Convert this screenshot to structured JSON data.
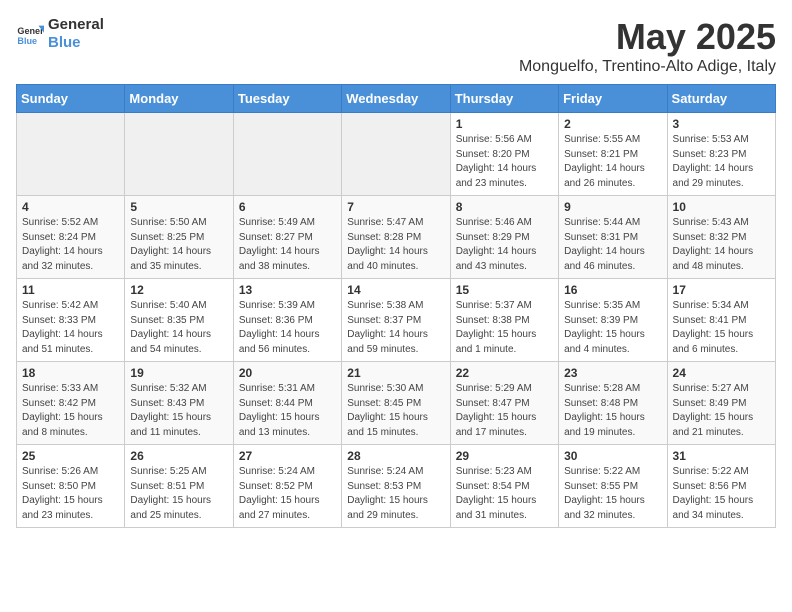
{
  "logo": {
    "line1": "General",
    "line2": "Blue"
  },
  "title": "May 2025",
  "subtitle": "Monguelfo, Trentino-Alto Adige, Italy",
  "headers": [
    "Sunday",
    "Monday",
    "Tuesday",
    "Wednesday",
    "Thursday",
    "Friday",
    "Saturday"
  ],
  "weeks": [
    [
      {
        "day": "",
        "content": ""
      },
      {
        "day": "",
        "content": ""
      },
      {
        "day": "",
        "content": ""
      },
      {
        "day": "",
        "content": ""
      },
      {
        "day": "1",
        "content": "Sunrise: 5:56 AM\nSunset: 8:20 PM\nDaylight: 14 hours and 23 minutes."
      },
      {
        "day": "2",
        "content": "Sunrise: 5:55 AM\nSunset: 8:21 PM\nDaylight: 14 hours and 26 minutes."
      },
      {
        "day": "3",
        "content": "Sunrise: 5:53 AM\nSunset: 8:23 PM\nDaylight: 14 hours and 29 minutes."
      }
    ],
    [
      {
        "day": "4",
        "content": "Sunrise: 5:52 AM\nSunset: 8:24 PM\nDaylight: 14 hours and 32 minutes."
      },
      {
        "day": "5",
        "content": "Sunrise: 5:50 AM\nSunset: 8:25 PM\nDaylight: 14 hours and 35 minutes."
      },
      {
        "day": "6",
        "content": "Sunrise: 5:49 AM\nSunset: 8:27 PM\nDaylight: 14 hours and 38 minutes."
      },
      {
        "day": "7",
        "content": "Sunrise: 5:47 AM\nSunset: 8:28 PM\nDaylight: 14 hours and 40 minutes."
      },
      {
        "day": "8",
        "content": "Sunrise: 5:46 AM\nSunset: 8:29 PM\nDaylight: 14 hours and 43 minutes."
      },
      {
        "day": "9",
        "content": "Sunrise: 5:44 AM\nSunset: 8:31 PM\nDaylight: 14 hours and 46 minutes."
      },
      {
        "day": "10",
        "content": "Sunrise: 5:43 AM\nSunset: 8:32 PM\nDaylight: 14 hours and 48 minutes."
      }
    ],
    [
      {
        "day": "11",
        "content": "Sunrise: 5:42 AM\nSunset: 8:33 PM\nDaylight: 14 hours and 51 minutes."
      },
      {
        "day": "12",
        "content": "Sunrise: 5:40 AM\nSunset: 8:35 PM\nDaylight: 14 hours and 54 minutes."
      },
      {
        "day": "13",
        "content": "Sunrise: 5:39 AM\nSunset: 8:36 PM\nDaylight: 14 hours and 56 minutes."
      },
      {
        "day": "14",
        "content": "Sunrise: 5:38 AM\nSunset: 8:37 PM\nDaylight: 14 hours and 59 minutes."
      },
      {
        "day": "15",
        "content": "Sunrise: 5:37 AM\nSunset: 8:38 PM\nDaylight: 15 hours and 1 minute."
      },
      {
        "day": "16",
        "content": "Sunrise: 5:35 AM\nSunset: 8:39 PM\nDaylight: 15 hours and 4 minutes."
      },
      {
        "day": "17",
        "content": "Sunrise: 5:34 AM\nSunset: 8:41 PM\nDaylight: 15 hours and 6 minutes."
      }
    ],
    [
      {
        "day": "18",
        "content": "Sunrise: 5:33 AM\nSunset: 8:42 PM\nDaylight: 15 hours and 8 minutes."
      },
      {
        "day": "19",
        "content": "Sunrise: 5:32 AM\nSunset: 8:43 PM\nDaylight: 15 hours and 11 minutes."
      },
      {
        "day": "20",
        "content": "Sunrise: 5:31 AM\nSunset: 8:44 PM\nDaylight: 15 hours and 13 minutes."
      },
      {
        "day": "21",
        "content": "Sunrise: 5:30 AM\nSunset: 8:45 PM\nDaylight: 15 hours and 15 minutes."
      },
      {
        "day": "22",
        "content": "Sunrise: 5:29 AM\nSunset: 8:47 PM\nDaylight: 15 hours and 17 minutes."
      },
      {
        "day": "23",
        "content": "Sunrise: 5:28 AM\nSunset: 8:48 PM\nDaylight: 15 hours and 19 minutes."
      },
      {
        "day": "24",
        "content": "Sunrise: 5:27 AM\nSunset: 8:49 PM\nDaylight: 15 hours and 21 minutes."
      }
    ],
    [
      {
        "day": "25",
        "content": "Sunrise: 5:26 AM\nSunset: 8:50 PM\nDaylight: 15 hours and 23 minutes."
      },
      {
        "day": "26",
        "content": "Sunrise: 5:25 AM\nSunset: 8:51 PM\nDaylight: 15 hours and 25 minutes."
      },
      {
        "day": "27",
        "content": "Sunrise: 5:24 AM\nSunset: 8:52 PM\nDaylight: 15 hours and 27 minutes."
      },
      {
        "day": "28",
        "content": "Sunrise: 5:24 AM\nSunset: 8:53 PM\nDaylight: 15 hours and 29 minutes."
      },
      {
        "day": "29",
        "content": "Sunrise: 5:23 AM\nSunset: 8:54 PM\nDaylight: 15 hours and 31 minutes."
      },
      {
        "day": "30",
        "content": "Sunrise: 5:22 AM\nSunset: 8:55 PM\nDaylight: 15 hours and 32 minutes."
      },
      {
        "day": "31",
        "content": "Sunrise: 5:22 AM\nSunset: 8:56 PM\nDaylight: 15 hours and 34 minutes."
      }
    ]
  ]
}
